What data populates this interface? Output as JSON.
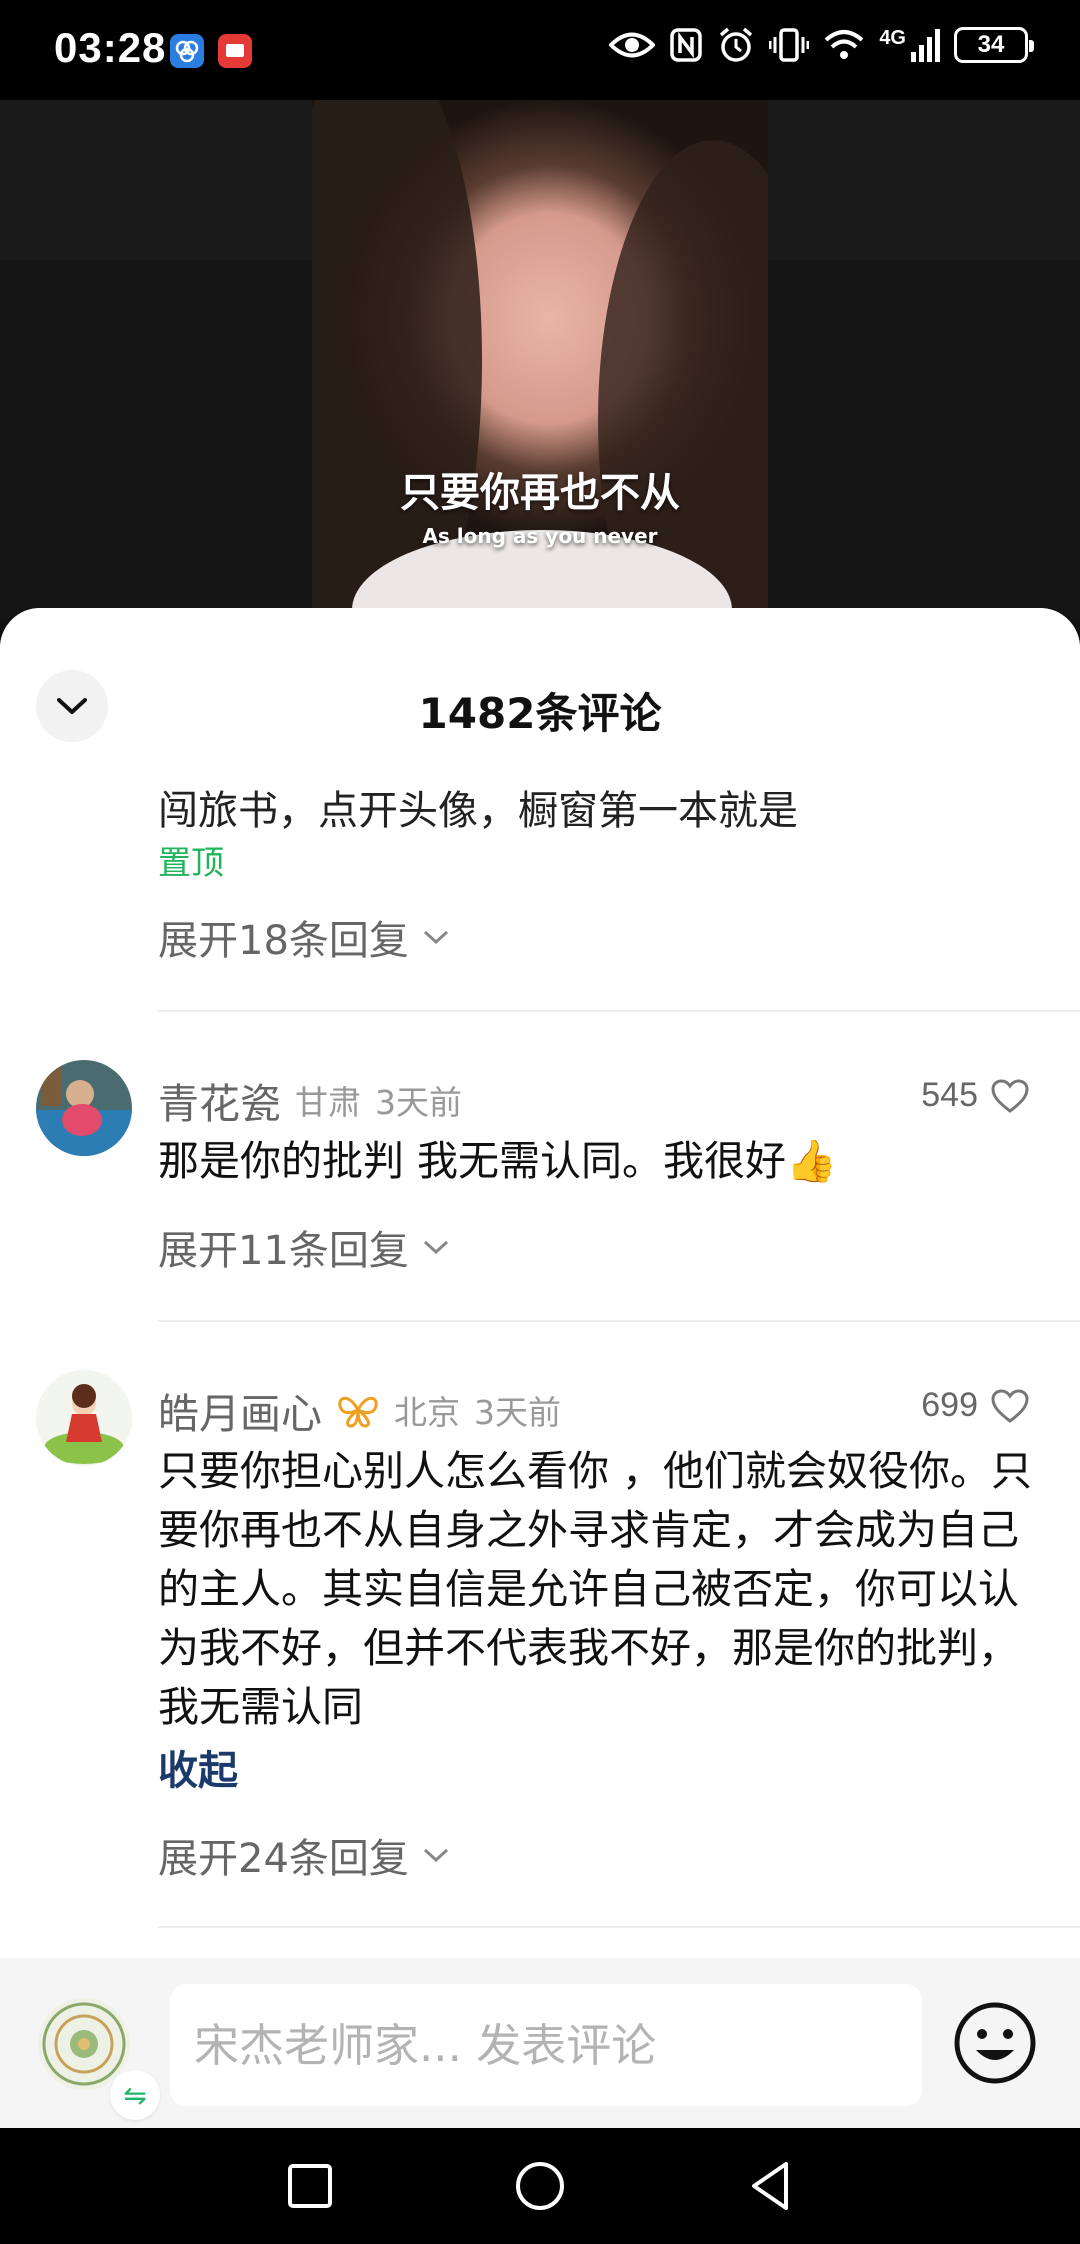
{
  "status_bar": {
    "time": "03:28",
    "battery": "34",
    "network": "4G",
    "icons": [
      "eye-icon",
      "nfc-icon",
      "alarm-icon",
      "vibrate-icon",
      "wifi-icon",
      "signal-icon",
      "battery-icon"
    ]
  },
  "video": {
    "caption_cn": "只要你再也不从",
    "caption_en": "As long as you never"
  },
  "sheet": {
    "title": "1482条评论",
    "collapse_icon": "chevron-down-icon"
  },
  "pinned_comment": {
    "partial_text": "闯旅书，点开头像，橱窗第一本就是",
    "pinned_label": "置顶",
    "expand_label": "展开18条回复"
  },
  "comments": [
    {
      "username": "青花瓷",
      "location": "甘肃",
      "time": "3天前",
      "likes": "545",
      "text": "那是你的批判 我无需认同。我很好👍",
      "expand_label": "展开11条回复"
    },
    {
      "username": "皓月画心",
      "badge_icon": "butterfly-badge-icon",
      "location": "北京",
      "time": "3天前",
      "likes": "699",
      "text": "只要你担心别人怎么看你 ，他们就会奴役你。只要你再也不从自身之外寻求肯定，才会成为自己的主人。其实自信是允许自己被否定，你可以认为我不好，但并不代表我不好，那是你的批判，我无需认同",
      "collapse_label": "收起",
      "expand_label": "展开24条回复"
    }
  ],
  "input_bar": {
    "placeholder": "宋杰老师家... 发表评论",
    "switch_icon": "⇋"
  },
  "colors": {
    "pinned_green": "#21b45b",
    "link_blue": "#1b3a6b",
    "badge_orange": "#f0a020"
  }
}
